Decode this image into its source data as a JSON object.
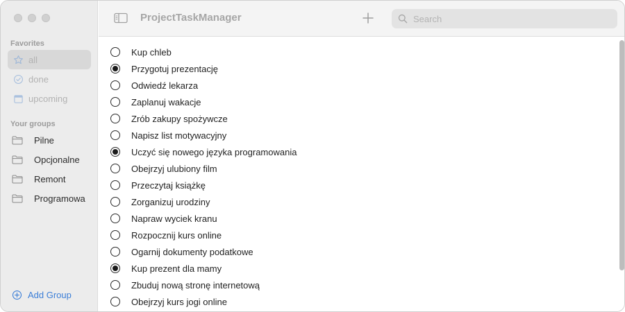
{
  "app": {
    "title": "ProjectTaskManager"
  },
  "search": {
    "placeholder": "Search",
    "value": ""
  },
  "sidebar": {
    "favorites_title": "Favorites",
    "favorites": [
      {
        "label": "all",
        "icon": "star-icon",
        "active": true
      },
      {
        "label": "done",
        "icon": "checkmark-circle-icon",
        "active": false
      },
      {
        "label": "upcoming",
        "icon": "calendar-icon",
        "active": false
      }
    ],
    "groups_title": "Your groups",
    "groups": [
      {
        "label": "Pilne",
        "icon": "folder-icon"
      },
      {
        "label": "Opcjonalne",
        "icon": "folder-icon"
      },
      {
        "label": "Remont",
        "icon": "folder-icon"
      },
      {
        "label": "Programowa",
        "icon": "folder-icon"
      }
    ],
    "add_group_label": "Add Group"
  },
  "tasks": [
    {
      "label": "Kup chleb",
      "done": false
    },
    {
      "label": "Przygotuj prezentację",
      "done": true
    },
    {
      "label": "Odwiedź lekarza",
      "done": false
    },
    {
      "label": "Zaplanuj wakacje",
      "done": false
    },
    {
      "label": "Zrób zakupy spożywcze",
      "done": false
    },
    {
      "label": "Napisz list motywacyjny",
      "done": false
    },
    {
      "label": "Uczyć się nowego języka programowania",
      "done": true
    },
    {
      "label": "Obejrzyj ulubiony film",
      "done": false
    },
    {
      "label": "Przeczytaj książkę",
      "done": false
    },
    {
      "label": "Zorganizuj urodziny",
      "done": false
    },
    {
      "label": "Napraw wyciek kranu",
      "done": false
    },
    {
      "label": "Rozpocznij kurs online",
      "done": false
    },
    {
      "label": "Ogarnij dokumenty podatkowe",
      "done": false
    },
    {
      "label": "Kup prezent dla mamy",
      "done": true
    },
    {
      "label": "Zbuduj nową stronę internetową",
      "done": false
    },
    {
      "label": "Obejrzyj kurs jogi online",
      "done": false
    }
  ],
  "colors": {
    "accent": "#3b7ed7",
    "sidebar_bg": "#ececec",
    "toolbar_bg": "#f4f4f4"
  }
}
